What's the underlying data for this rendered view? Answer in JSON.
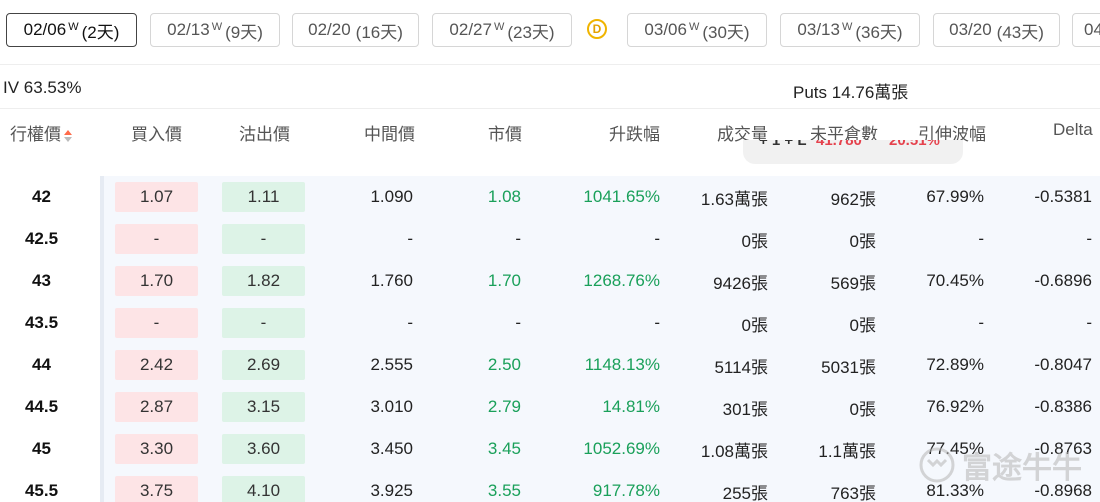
{
  "expiry_tabs": [
    {
      "date": "02/06",
      "weekly": "W",
      "days": "(2天)",
      "active": true
    },
    {
      "date": "02/13",
      "weekly": "W",
      "days": "(9天)"
    },
    {
      "date": "02/20",
      "weekly": "",
      "days": "(16天)"
    },
    {
      "date": "02/27",
      "weekly": "W",
      "days": "(23天)"
    },
    {
      "date": "03/06",
      "weekly": "W",
      "days": "(30天)"
    },
    {
      "date": "03/13",
      "weekly": "W",
      "days": "(36天)"
    },
    {
      "date": "03/20",
      "weekly": "",
      "days": "(43天)"
    },
    {
      "date": "04",
      "weekly": "",
      "days": ""
    }
  ],
  "dividend_badge": "D",
  "iv_label": "IV 63.53%",
  "puts_label": "Puts 14.76萬張",
  "headers": {
    "strike": "行權價",
    "bid": "買入價",
    "ask": "沽出價",
    "mid": "中間價",
    "market": "市價",
    "change": "升跌幅",
    "volume": "成交量",
    "open_interest": "未平倉數",
    "iv": "引伸波幅",
    "delta": "Delta"
  },
  "tooltip_fragment": {
    "left": "+ 1 + L",
    "mid": "41.780",
    "right": "20.51%"
  },
  "rows": [
    {
      "strike": "42",
      "bid": "1.07",
      "ask": "1.11",
      "mid": "1.090",
      "market": "1.08",
      "change": "1041.65%",
      "volume": "1.63萬張",
      "oi": "962張",
      "iv": "67.99%",
      "delta": "-0.5381"
    },
    {
      "strike": "42.5",
      "bid": "-",
      "ask": "-",
      "mid": "-",
      "market": "-",
      "change": "-",
      "volume": "0張",
      "oi": "0張",
      "iv": "-",
      "delta": "-"
    },
    {
      "strike": "43",
      "bid": "1.70",
      "ask": "1.82",
      "mid": "1.760",
      "market": "1.70",
      "change": "1268.76%",
      "volume": "9426張",
      "oi": "569張",
      "iv": "70.45%",
      "delta": "-0.6896"
    },
    {
      "strike": "43.5",
      "bid": "-",
      "ask": "-",
      "mid": "-",
      "market": "-",
      "change": "-",
      "volume": "0張",
      "oi": "0張",
      "iv": "-",
      "delta": "-"
    },
    {
      "strike": "44",
      "bid": "2.42",
      "ask": "2.69",
      "mid": "2.555",
      "market": "2.50",
      "change": "1148.13%",
      "volume": "5114張",
      "oi": "5031張",
      "iv": "72.89%",
      "delta": "-0.8047"
    },
    {
      "strike": "44.5",
      "bid": "2.87",
      "ask": "3.15",
      "mid": "3.010",
      "market": "2.79",
      "change": "14.81%",
      "volume": "301張",
      "oi": "0張",
      "iv": "76.92%",
      "delta": "-0.8386"
    },
    {
      "strike": "45",
      "bid": "3.30",
      "ask": "3.60",
      "mid": "3.450",
      "market": "3.45",
      "change": "1052.69%",
      "volume": "1.08萬張",
      "oi": "1.1萬張",
      "iv": "77.45%",
      "delta": "-0.8763"
    },
    {
      "strike": "45.5",
      "bid": "3.75",
      "ask": "4.10",
      "mid": "3.925",
      "market": "3.55",
      "change": "917.78%",
      "volume": "255張",
      "oi": "763張",
      "iv": "81.33%",
      "delta": "-0.8968"
    }
  ],
  "watermark": "富途牛牛",
  "colors": {
    "up": "#1aa05a",
    "down": "#e5424d",
    "bid_bg": "#fde4e6",
    "ask_bg": "#ddf3e7",
    "badge": "#f0b400"
  }
}
